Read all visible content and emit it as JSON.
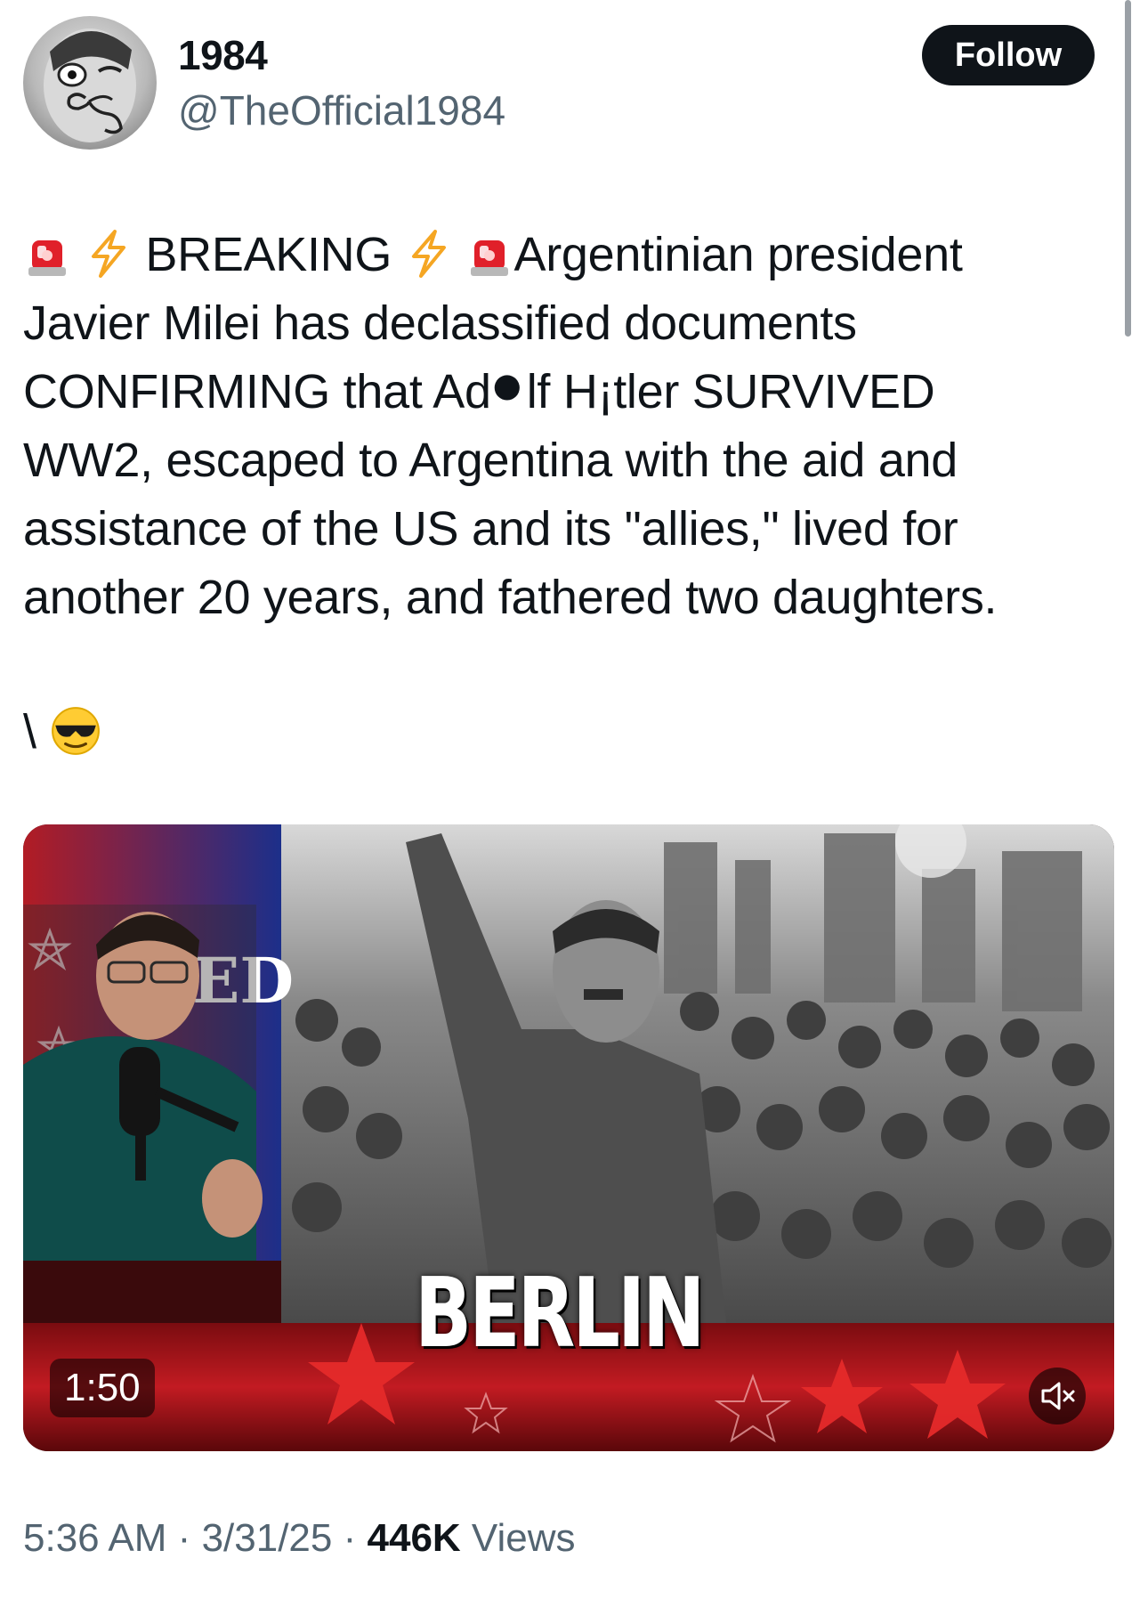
{
  "author": {
    "display_name": "1984",
    "handle": "@TheOfficial1984",
    "follow_label": "Follow",
    "avatar_icon": "surreal-mustache-portrait"
  },
  "tweet": {
    "lines": [
      {
        "pre": "",
        "word": "BREAKING",
        "post": "Argentinian president"
      },
      "Javier Milei has declassified documents",
      {
        "pre": "CONFIRMING that Ad",
        "post": "lf H¡tler SURVIVED"
      },
      "WW2, escaped to Argentina with the aid and",
      "assistance of the US and its \"allies,\" lived for",
      "another 20 years, and fathered two daughters."
    ],
    "icons": [
      "rotating-light-icon",
      "lightning-icon"
    ],
    "trailing": "\\",
    "trailing_icon": "sunglasses-face-icon"
  },
  "media": {
    "duration": "1:50",
    "caption": "BERLIN",
    "studio_text": "ED",
    "mute_icon": "muted-speaker-icon"
  },
  "meta": {
    "time": "5:36 AM",
    "separator": "·",
    "date": "3/31/25",
    "views_count": "446K",
    "views_label": "Views"
  },
  "colors": {
    "text": "#0f1419",
    "secondary": "#536471",
    "follow_bg": "#0f1419",
    "siren_red": "#e0202a",
    "lightning": "#f5a623"
  }
}
